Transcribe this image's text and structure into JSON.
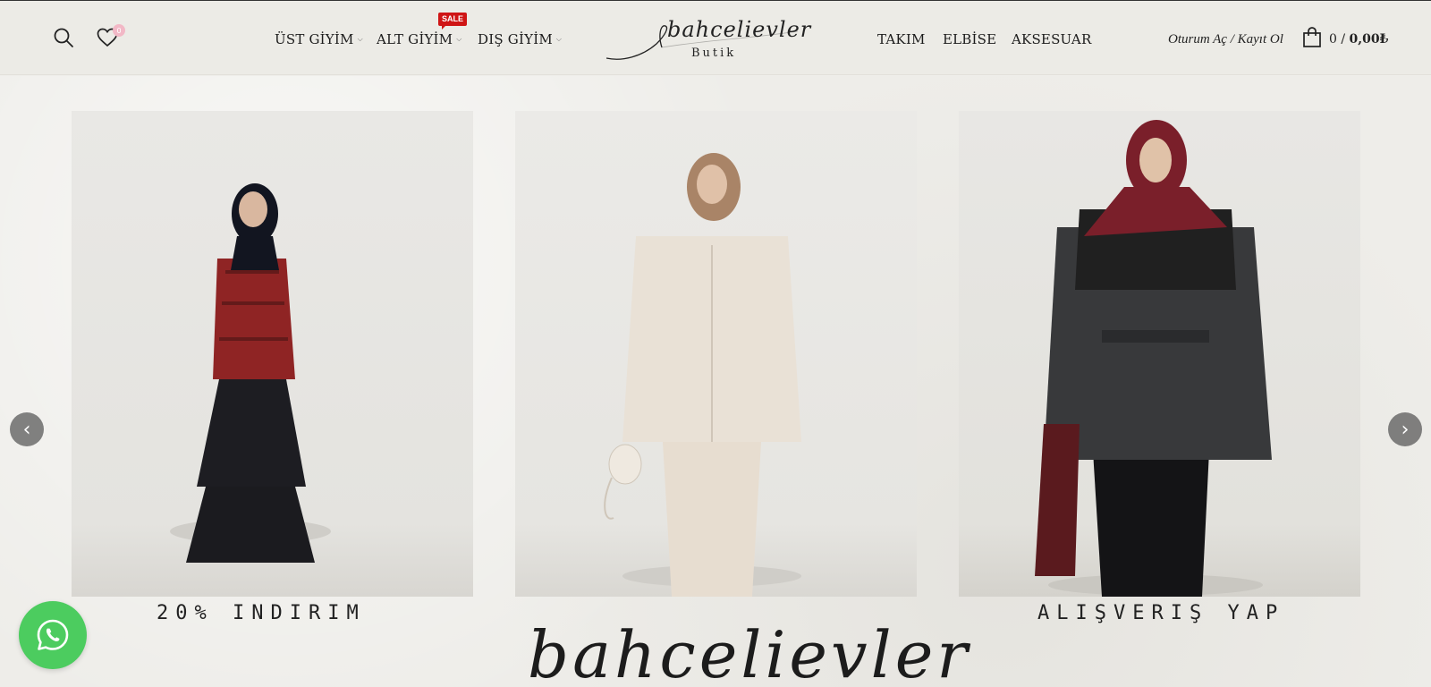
{
  "header": {
    "nav_left": [
      {
        "label": "ÜST GİYİM"
      },
      {
        "label": "ALT GİYİM",
        "badge": "SALE"
      },
      {
        "label": "DIŞ GİYİM"
      }
    ],
    "nav_right": [
      {
        "label": "TAKIM"
      },
      {
        "label": "ELBİSE"
      },
      {
        "label": "AKSESUAR"
      }
    ],
    "logo": {
      "script": "bahcelievler",
      "sub": "Butik"
    },
    "wishlist_count": "0",
    "account_link": "Oturum Aç / Kayıt Ol",
    "cart": {
      "count": "0",
      "separator": "/",
      "total": "0,00₺"
    },
    "icons": {
      "search": "search-icon",
      "wishlist": "heart-icon",
      "cart": "shopping-bag-icon",
      "caret": "chevron-down-icon"
    }
  },
  "hero": {
    "captions": [
      "20% INDIRIM",
      "ALIŞVERIŞ YAP"
    ],
    "bottom_script": "bahcelievler",
    "prev_label": "‹",
    "next_label": "›"
  },
  "colors": {
    "sale": "#cf1515",
    "whatsapp": "#4ccc5f",
    "wish_badge": "#f2b8c6"
  }
}
